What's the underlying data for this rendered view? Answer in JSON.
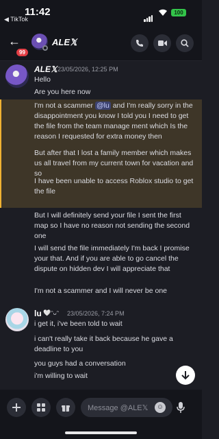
{
  "status_bar": {
    "time": "11:42",
    "back_app": "◀ TikTok",
    "battery": "100"
  },
  "header": {
    "back_icon": "←",
    "unread_badge": "99",
    "name": "ALE𝕏",
    "chevron": "›"
  },
  "messages": [
    {
      "author": "ALE𝕏",
      "timestamp": "23/05/2026, 12:25 PM",
      "lines": [
        "Hello",
        "Are you here now"
      ],
      "highlight": {
        "before_mention": "I'm not a scammer ",
        "mention": "@lu",
        "after_mention": " and I'm really sorry in the disappointment you know I told you I need to get the file from the team manage ment which Is the reason I requested for extra money then",
        "para2": "But after that I lost a family member which makes us all travel from my current town for vacation and so",
        "para3": "I have been unable to access Roblox studio to get the file"
      },
      "after": [
        "But I will definitely send your file I sent the first map so I have no reason not sending the second one",
        "I will send the file immediately I'm back I promise your that. And if you are able to go cancel the dispute on hidden dev I will appreciate that",
        "I'm not a scammer and I will never be one"
      ]
    },
    {
      "author": "lu",
      "author_tag": "🤍ᵔᴗᵔ",
      "timestamp": "23/05/2026, 7:24 PM",
      "lines": [
        "i get it, i've been told to wait",
        "i can't really take it back because he gave a deadline to you",
        "you guys had a conversation",
        "i'm willing to wait"
      ]
    }
  ],
  "composer": {
    "placeholder": "Message @ALE𝕏"
  }
}
